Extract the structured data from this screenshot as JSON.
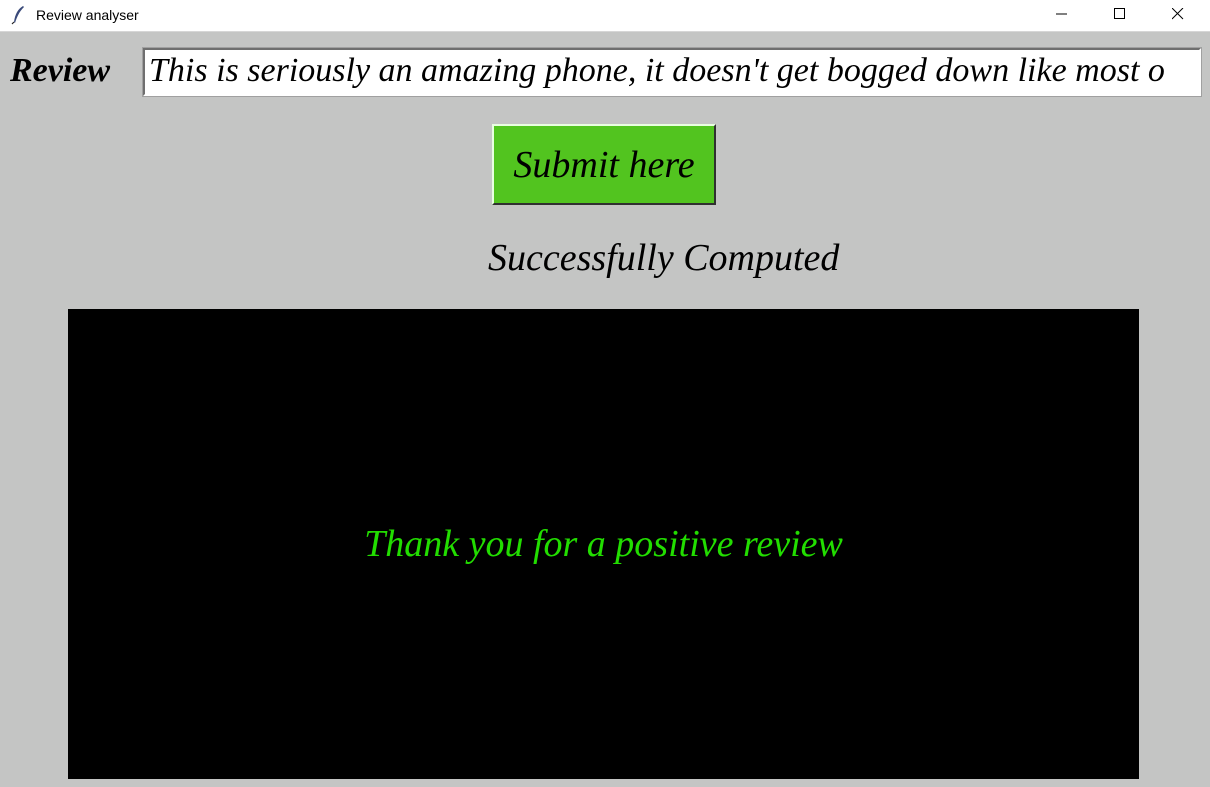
{
  "window": {
    "title": "Review analyser",
    "app_icon": "feather-icon",
    "controls": [
      "minimize-icon",
      "maximize-icon",
      "close-icon"
    ]
  },
  "form": {
    "review_label": "Review",
    "review_value": "This is seriously an amazing phone, it doesn't get bogged down like most o",
    "submit_label": "Submit here"
  },
  "status": {
    "text": "Successfully Computed"
  },
  "output": {
    "message": "Thank you for a positive review",
    "message_color": "#22dd00",
    "panel_color": "#000000"
  },
  "colors": {
    "background": "#c4c5c4",
    "submit_button": "#52c41f"
  }
}
